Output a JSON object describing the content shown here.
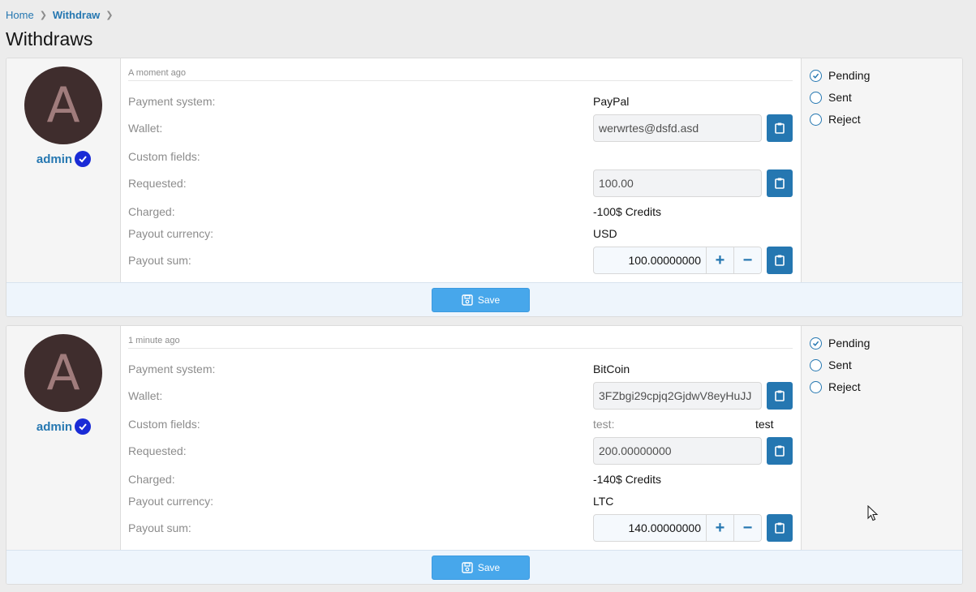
{
  "breadcrumb": {
    "home": "Home",
    "current": "Withdraw"
  },
  "page_title": "Withdraws",
  "labels": {
    "payment_system": "Payment system:",
    "wallet": "Wallet:",
    "custom_fields": "Custom fields:",
    "requested": "Requested:",
    "charged": "Charged:",
    "payout_currency": "Payout currency:",
    "payout_sum": "Payout sum:"
  },
  "status_options": [
    "Pending",
    "Sent",
    "Reject"
  ],
  "save_label": "Save",
  "colors": {
    "accent": "#2577b1",
    "save": "#47a7eb",
    "avatar_bg": "#3f2d2d"
  },
  "withdrawals": [
    {
      "time": "A moment ago",
      "avatar_letter": "A",
      "username": "admin",
      "payment_system": "PayPal",
      "wallet": "werwrtes@dsfd.asd",
      "custom_field_key": "",
      "custom_field_value": "",
      "requested": "100.00",
      "charged": "-100$ Credits",
      "payout_currency": "USD",
      "payout_sum": "100.00000000",
      "status": "Pending"
    },
    {
      "time": "1 minute ago",
      "avatar_letter": "A",
      "username": "admin",
      "payment_system": "BitCoin",
      "wallet": "3FZbgi29cpjq2GjdwV8eyHuJJ",
      "custom_field_key": "test:",
      "custom_field_value": "test",
      "requested": "200.00000000",
      "charged": "-140$ Credits",
      "payout_currency": "LTC",
      "payout_sum": "140.00000000",
      "status": "Pending"
    }
  ]
}
